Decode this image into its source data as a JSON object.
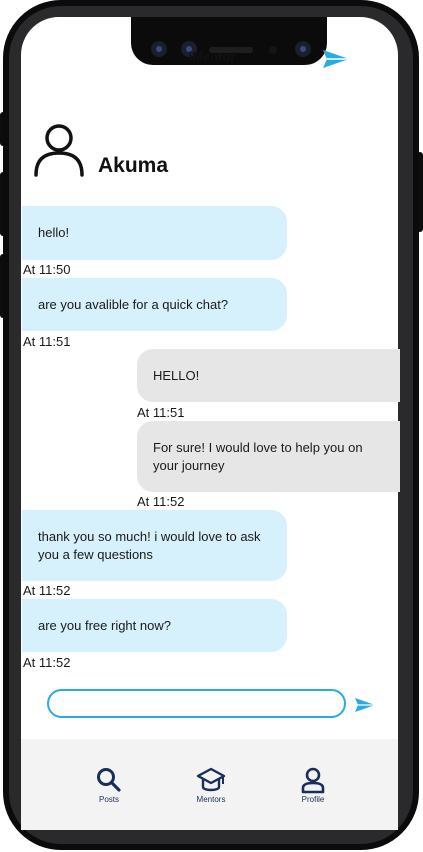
{
  "header": {
    "title": "iMentor",
    "send_icon": "send-icon",
    "accent": "#29abe2"
  },
  "contact": {
    "name": "Akuma",
    "icon": "user-icon"
  },
  "messages": [
    {
      "side": "in",
      "text": "hello!",
      "time": "At 11:50"
    },
    {
      "side": "in",
      "text": "are you avalible for a quick chat?",
      "time": "At 11:51"
    },
    {
      "side": "out",
      "text": "HELLO!",
      "time": "At 11:51"
    },
    {
      "side": "out",
      "text": "For sure! I would love to help you on your journey",
      "time": "At 11:52"
    },
    {
      "side": "in",
      "text": "thank you so much! i would love to ask you a few questions",
      "time": "At 11:52"
    },
    {
      "side": "in",
      "text": "are you free right now?",
      "time": "At 11:52"
    }
  ],
  "composer": {
    "value": "",
    "send_icon": "send-icon"
  },
  "tabs": [
    {
      "label": "Posts",
      "icon": "search-icon"
    },
    {
      "label": "Mentors",
      "icon": "graduation-cap-icon"
    },
    {
      "label": "Profile",
      "icon": "user-icon"
    }
  ],
  "colors": {
    "incoming_bubble": "#d6f0fc",
    "outgoing_bubble": "#e6e6e6",
    "tab_icon": "#1a2e5a"
  }
}
